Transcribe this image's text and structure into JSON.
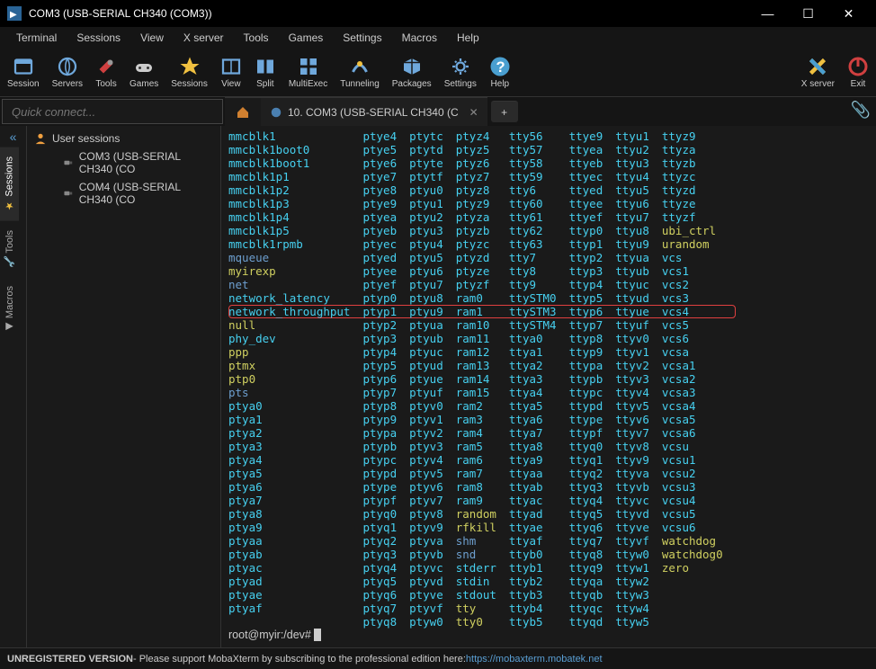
{
  "title": "COM3  (USB-SERIAL CH340 (COM3))",
  "window_controls": {
    "min": "—",
    "max": "☐",
    "close": "✕"
  },
  "menu": [
    "Terminal",
    "Sessions",
    "View",
    "X server",
    "Tools",
    "Games",
    "Settings",
    "Macros",
    "Help"
  ],
  "toolbar": [
    {
      "label": "Session",
      "icon": "session"
    },
    {
      "label": "Servers",
      "icon": "servers"
    },
    {
      "label": "Tools",
      "icon": "tools"
    },
    {
      "label": "Games",
      "icon": "games"
    },
    {
      "label": "Sessions",
      "icon": "star"
    },
    {
      "label": "View",
      "icon": "view"
    },
    {
      "label": "Split",
      "icon": "split"
    },
    {
      "label": "MultiExec",
      "icon": "multiexec"
    },
    {
      "label": "Tunneling",
      "icon": "tunneling"
    },
    {
      "label": "Packages",
      "icon": "packages"
    },
    {
      "label": "Settings",
      "icon": "settings"
    },
    {
      "label": "Help",
      "icon": "help"
    }
  ],
  "toolbar_right": [
    {
      "label": "X server",
      "icon": "xserver"
    },
    {
      "label": "Exit",
      "icon": "exit"
    }
  ],
  "quick_connect_placeholder": "Quick connect...",
  "tabs": {
    "active": {
      "label": "10. COM3  (USB-SERIAL CH340 (C"
    },
    "add": "+"
  },
  "rail": [
    {
      "label": "Sessions",
      "icon": "star",
      "active": true
    },
    {
      "label": "Tools",
      "icon": "wrench"
    },
    {
      "label": "Macros",
      "icon": "arrow"
    }
  ],
  "sidebar": {
    "root": "User sessions",
    "children": [
      "COM3  (USB-SERIAL CH340 (CO",
      "COM4  (USB-SERIAL CH340 (CO"
    ]
  },
  "terminal_rows": [
    [
      "mmcblk1",
      "ptye4",
      "ptytc",
      "ptyz4",
      "tty56",
      "ttye9",
      "ttyu1",
      "ttyz9"
    ],
    [
      "mmcblk1boot0",
      "ptye5",
      "ptytd",
      "ptyz5",
      "tty57",
      "ttyea",
      "ttyu2",
      "ttyza"
    ],
    [
      "mmcblk1boot1",
      "ptye6",
      "ptyte",
      "ptyz6",
      "tty58",
      "ttyeb",
      "ttyu3",
      "ttyzb"
    ],
    [
      "mmcblk1p1",
      "ptye7",
      "ptytf",
      "ptyz7",
      "tty59",
      "ttyec",
      "ttyu4",
      "ttyzc"
    ],
    [
      "mmcblk1p2",
      "ptye8",
      "ptyu0",
      "ptyz8",
      "tty6",
      "ttyed",
      "ttyu5",
      "ttyzd"
    ],
    [
      "mmcblk1p3",
      "ptye9",
      "ptyu1",
      "ptyz9",
      "tty60",
      "ttyee",
      "ttyu6",
      "ttyze"
    ],
    [
      "mmcblk1p4",
      "ptyea",
      "ptyu2",
      "ptyza",
      "tty61",
      "ttyef",
      "ttyu7",
      "ttyzf"
    ],
    [
      "mmcblk1p5",
      "ptyeb",
      "ptyu3",
      "ptyzb",
      "tty62",
      "ttyp0",
      "ttyu8",
      "ubi_ctrl"
    ],
    [
      "mmcblk1rpmb",
      "ptyec",
      "ptyu4",
      "ptyzc",
      "tty63",
      "ttyp1",
      "ttyu9",
      "urandom"
    ],
    [
      "mqueue",
      "ptyed",
      "ptyu5",
      "ptyzd",
      "tty7",
      "ttyp2",
      "ttyua",
      "vcs"
    ],
    [
      "myirexp",
      "ptyee",
      "ptyu6",
      "ptyze",
      "tty8",
      "ttyp3",
      "ttyub",
      "vcs1"
    ],
    [
      "net",
      "ptyef",
      "ptyu7",
      "ptyzf",
      "tty9",
      "ttyp4",
      "ttyuc",
      "vcs2"
    ],
    [
      "network_latency",
      "ptyp0",
      "ptyu8",
      "ram0",
      "ttySTM0",
      "ttyp5",
      "ttyud",
      "vcs3"
    ],
    [
      "network_throughput",
      "ptyp1",
      "ptyu9",
      "ram1",
      "ttySTM3",
      "ttyp6",
      "ttyue",
      "vcs4"
    ],
    [
      "null",
      "ptyp2",
      "ptyua",
      "ram10",
      "ttySTM4",
      "ttyp7",
      "ttyuf",
      "vcs5"
    ],
    [
      "phy_dev",
      "ptyp3",
      "ptyub",
      "ram11",
      "ttya0",
      "ttyp8",
      "ttyv0",
      "vcs6"
    ],
    [
      "ppp",
      "ptyp4",
      "ptyuc",
      "ram12",
      "ttya1",
      "ttyp9",
      "ttyv1",
      "vcsa"
    ],
    [
      "ptmx",
      "ptyp5",
      "ptyud",
      "ram13",
      "ttya2",
      "ttypa",
      "ttyv2",
      "vcsa1"
    ],
    [
      "ptp0",
      "ptyp6",
      "ptyue",
      "ram14",
      "ttya3",
      "ttypb",
      "ttyv3",
      "vcsa2"
    ],
    [
      "pts",
      "ptyp7",
      "ptyuf",
      "ram15",
      "ttya4",
      "ttypc",
      "ttyv4",
      "vcsa3"
    ],
    [
      "ptya0",
      "ptyp8",
      "ptyv0",
      "ram2",
      "ttya5",
      "ttypd",
      "ttyv5",
      "vcsa4"
    ],
    [
      "ptya1",
      "ptyp9",
      "ptyv1",
      "ram3",
      "ttya6",
      "ttype",
      "ttyv6",
      "vcsa5"
    ],
    [
      "ptya2",
      "ptypa",
      "ptyv2",
      "ram4",
      "ttya7",
      "ttypf",
      "ttyv7",
      "vcsa6"
    ],
    [
      "ptya3",
      "ptypb",
      "ptyv3",
      "ram5",
      "ttya8",
      "ttyq0",
      "ttyv8",
      "vcsu"
    ],
    [
      "ptya4",
      "ptypc",
      "ptyv4",
      "ram6",
      "ttya9",
      "ttyq1",
      "ttyv9",
      "vcsu1"
    ],
    [
      "ptya5",
      "ptypd",
      "ptyv5",
      "ram7",
      "ttyaa",
      "ttyq2",
      "ttyva",
      "vcsu2"
    ],
    [
      "ptya6",
      "ptype",
      "ptyv6",
      "ram8",
      "ttyab",
      "ttyq3",
      "ttyvb",
      "vcsu3"
    ],
    [
      "ptya7",
      "ptypf",
      "ptyv7",
      "ram9",
      "ttyac",
      "ttyq4",
      "ttyvc",
      "vcsu4"
    ],
    [
      "ptya8",
      "ptyq0",
      "ptyv8",
      "random",
      "ttyad",
      "ttyq5",
      "ttyvd",
      "vcsu5"
    ],
    [
      "ptya9",
      "ptyq1",
      "ptyv9",
      "rfkill",
      "ttyae",
      "ttyq6",
      "ttyve",
      "vcsu6"
    ],
    [
      "ptyaa",
      "ptyq2",
      "ptyva",
      "shm",
      "ttyaf",
      "ttyq7",
      "ttyvf",
      "watchdog"
    ],
    [
      "ptyab",
      "ptyq3",
      "ptyvb",
      "snd",
      "ttyb0",
      "ttyq8",
      "ttyw0",
      "watchdog0"
    ],
    [
      "ptyac",
      "ptyq4",
      "ptyvc",
      "stderr",
      "ttyb1",
      "ttyq9",
      "ttyw1",
      "zero"
    ],
    [
      "ptyad",
      "ptyq5",
      "ptyvd",
      "stdin",
      "ttyb2",
      "ttyqa",
      "ttyw2",
      ""
    ],
    [
      "ptyae",
      "ptyq6",
      "ptyve",
      "stdout",
      "ttyb3",
      "ttyqb",
      "ttyw3",
      ""
    ],
    [
      "ptyaf",
      "ptyq7",
      "ptyvf",
      "tty",
      "ttyb4",
      "ttyqc",
      "ttyw4",
      ""
    ],
    [
      "",
      "ptyq8",
      "ptyw0",
      "tty0",
      "ttyb5",
      "ttyqd",
      "ttyw5",
      ""
    ]
  ],
  "terminal_highlight_row": 13,
  "terminal_colors": {
    "mqueue": "dir",
    "net": "dir",
    "pts": "dir",
    "shm": "dir",
    "snd": "dir",
    "myirexp": "yellow",
    "null": "yellow",
    "ptmx": "yellow",
    "ptp0": "yellow",
    "random": "yellow",
    "rfkill": "yellow",
    "stderr": "ls",
    "stdin": "ls",
    "stdout": "ls",
    "tty": "yellow",
    "tty0": "yellow",
    "urandom": "yellow",
    "zero": "yellow",
    "watchdog": "yellow",
    "watchdog0": "yellow",
    "ubi_ctrl": "yellow",
    "network_latency": "ls",
    "network_throughput": "ls",
    "phy_dev": "ls",
    "ppp": "yellow"
  },
  "prompt": "root@myir:/dev# ",
  "statusbar": {
    "prefix": "UNREGISTERED VERSION",
    "text": "  -  Please support MobaXterm by subscribing to the professional edition here:  ",
    "link": "https://mobaxterm.mobatek.net"
  }
}
